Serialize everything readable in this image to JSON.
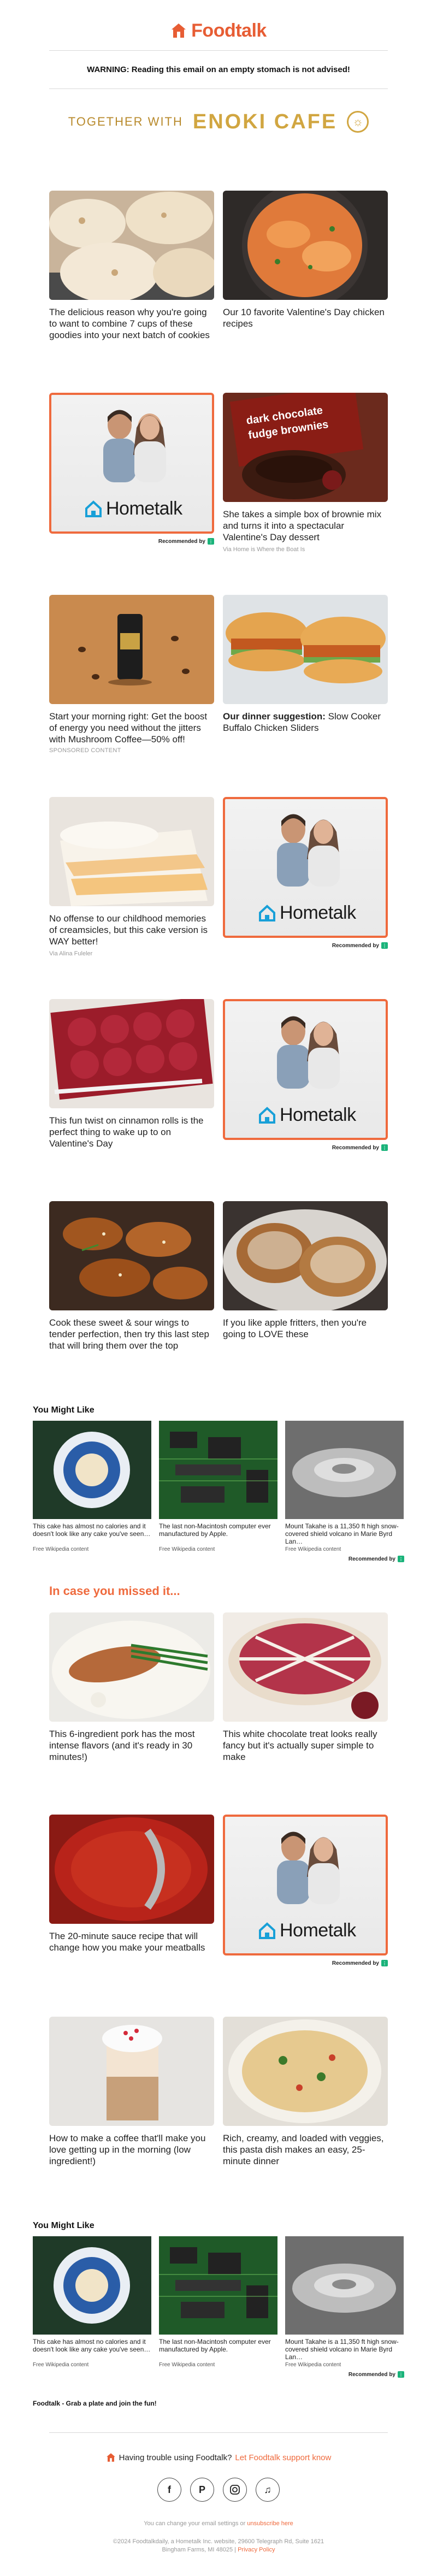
{
  "header": {
    "brand": "Foodtalk",
    "warning": "WARNING: Reading this email on an empty stomach is not advised!"
  },
  "sponsor": {
    "together_with": "TOGETHER WITH",
    "name": "ENOKI CAFE"
  },
  "colors": {
    "brand_orange": "#e75d34",
    "ad_border": "#ef6a3d",
    "recommended_badge": "#1ab37a"
  },
  "cards": [
    {
      "title": "The delicious reason why you're going to want to combine 7 cups of these goodies into your next batch of cookies",
      "source": "",
      "image": "cookies-photo"
    },
    {
      "title": "Our 10 favorite Valentine's Day chicken recipes",
      "source": "",
      "image": "chicken-skillet-photo"
    },
    {
      "ad": true,
      "brand": "Hometalk",
      "recommended": "Recommended by"
    },
    {
      "title": "She takes a simple box of brownie mix and turns it into a spectacular Valentine's Day dessert",
      "source": "Via Home is Where the Boat Is",
      "image": "brownie-photo"
    },
    {
      "title": "Start your morning right: Get the boost of energy you need without the jitters with Mushroom Coffee—50% off!",
      "sponsored": "SPONSORED CONTENT",
      "image": "coffee-can-photo"
    },
    {
      "title_bold": "Our dinner suggestion:",
      "title": " Slow Cooker Buffalo Chicken Sliders",
      "image": "sliders-photo"
    },
    {
      "title": "No offense to our childhood memories of creamsicles, but this cake version is WAY better!",
      "source": "Via Alina Fuleler",
      "image": "cake-photo"
    },
    {
      "ad": true,
      "brand": "Hometalk",
      "recommended": "Recommended by"
    },
    {
      "title": "This fun twist on cinnamon rolls is the perfect thing to wake up to on Valentine's Day",
      "image": "cinnamon-rolls-photo"
    },
    {
      "ad": true,
      "brand": "Hometalk",
      "recommended": "Recommended by"
    },
    {
      "title": "Cook these sweet & sour wings to tender perfection, then try this last step that will bring them over the top",
      "image": "wings-photo"
    },
    {
      "title": "If you like apple fritters, then you're going to LOVE these",
      "image": "fritters-photo"
    }
  ],
  "you_might_like_1": {
    "title": "You Might Like",
    "items": [
      {
        "text": "This cake has almost no calories and it doesn't look like any cake you've seen…",
        "source": "Free Wikipedia content"
      },
      {
        "text": "The last non-Macintosh computer ever manufactured by Apple.",
        "source": "Free Wikipedia content"
      },
      {
        "text": "Mount Takahe is a 11,350 ft high snow-covered shield volcano in Marie Byrd Lan…",
        "source": "Free Wikipedia content"
      }
    ],
    "recommended": "Recommended by"
  },
  "missed": {
    "title": "In case you missed it...",
    "cards": [
      {
        "title": "This 6-ingredient pork has the most intense flavors (and it's ready in 30 minutes!)",
        "image": "pork-photo"
      },
      {
        "title": "This white chocolate treat looks really fancy but it's actually super simple to make",
        "image": "tart-photo"
      },
      {
        "title": "The 20-minute sauce recipe that will change how you make your meatballs",
        "image": "sauce-photo"
      },
      {
        "ad": true,
        "brand": "Hometalk",
        "recommended": "Recommended by"
      },
      {
        "title": "How to make a coffee that'll make you love getting up in the morning (low ingredient!)",
        "image": "latte-photo"
      },
      {
        "title": "Rich, creamy, and loaded with veggies, this pasta dish makes an easy, 25-minute dinner",
        "image": "pasta-photo"
      }
    ]
  },
  "you_might_like_2": {
    "title": "You Might Like",
    "items": [
      {
        "text": "This cake has almost no calories and it doesn't look like any cake you've seen…",
        "source": "Free Wikipedia content"
      },
      {
        "text": "The last non-Macintosh computer ever manufactured by Apple.",
        "source": "Free Wikipedia content"
      },
      {
        "text": "Mount Takahe is a 11,350 ft high snow-covered shield volcano in Marie Byrd Lan…",
        "source": "Free Wikipedia content"
      }
    ],
    "recommended": "Recommended by"
  },
  "footer": {
    "tagline": "Foodtalk - Grab a plate and join the fun!",
    "trouble_text": "Having trouble using Foodtalk?",
    "trouble_link": "Let Foodtalk support know",
    "socials": [
      "f",
      "P",
      "IG",
      "TT"
    ],
    "unsub_prefix": "You can change your email settings or",
    "unsub_link": "unsubscribe here",
    "legal_line1": "©2024 Foodtalkdaily, a Hometalk Inc. website, 29600 Telegraph Rd, Suite 1621",
    "legal_line2": "Bingham Farms, MI 48025",
    "privacy": "Privacy Policy"
  }
}
